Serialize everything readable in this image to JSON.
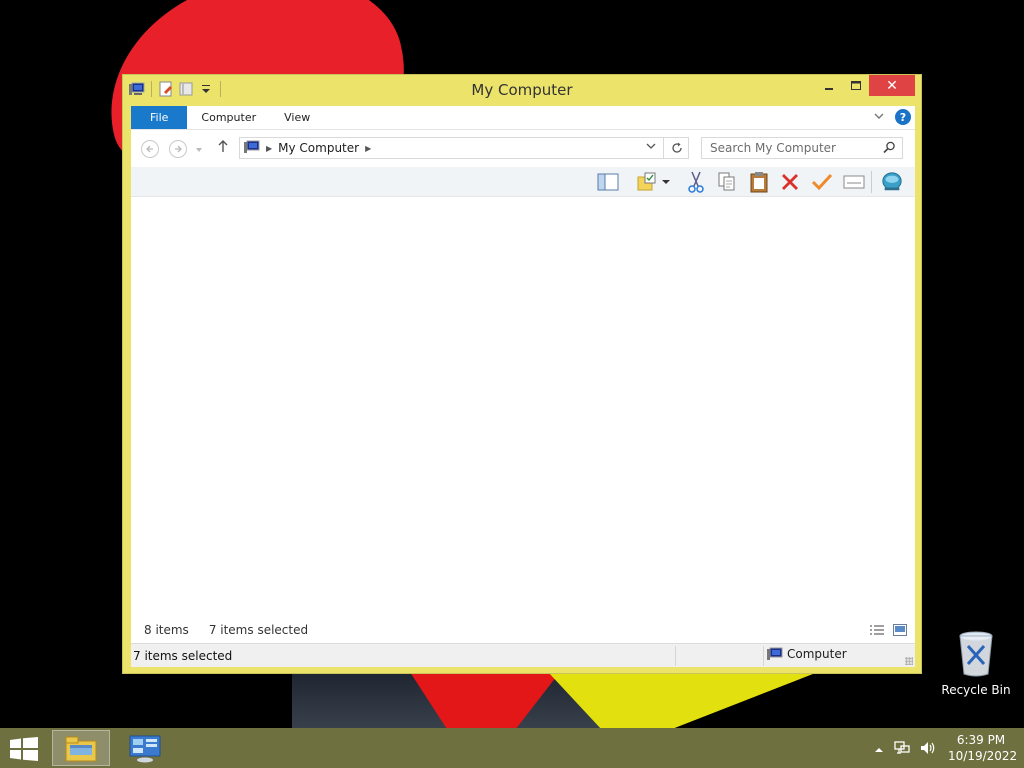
{
  "window": {
    "title": "My Computer",
    "caption_close": "✕",
    "caption_max": "☐",
    "caption_min": "—"
  },
  "ribbon": {
    "tabs": [
      {
        "label": "File"
      },
      {
        "label": "Computer"
      },
      {
        "label": "View"
      }
    ],
    "help": "?"
  },
  "address": {
    "path": "My Computer",
    "search_placeholder": "Search My Computer"
  },
  "status": {
    "item_count": "8 items",
    "selected_count": "7 items selected",
    "bottom_selected": "7 items selected",
    "location": "Computer"
  },
  "desktop": {
    "recycle_bin_label": "Recycle Bin"
  },
  "taskbar": {
    "time": "6:39 PM",
    "date": "10/19/2022",
    "colors": {
      "taskbar": "#6f7040",
      "window_frame": "#ebe36a",
      "file_tab": "#1979ca",
      "close": "#e04343"
    }
  }
}
